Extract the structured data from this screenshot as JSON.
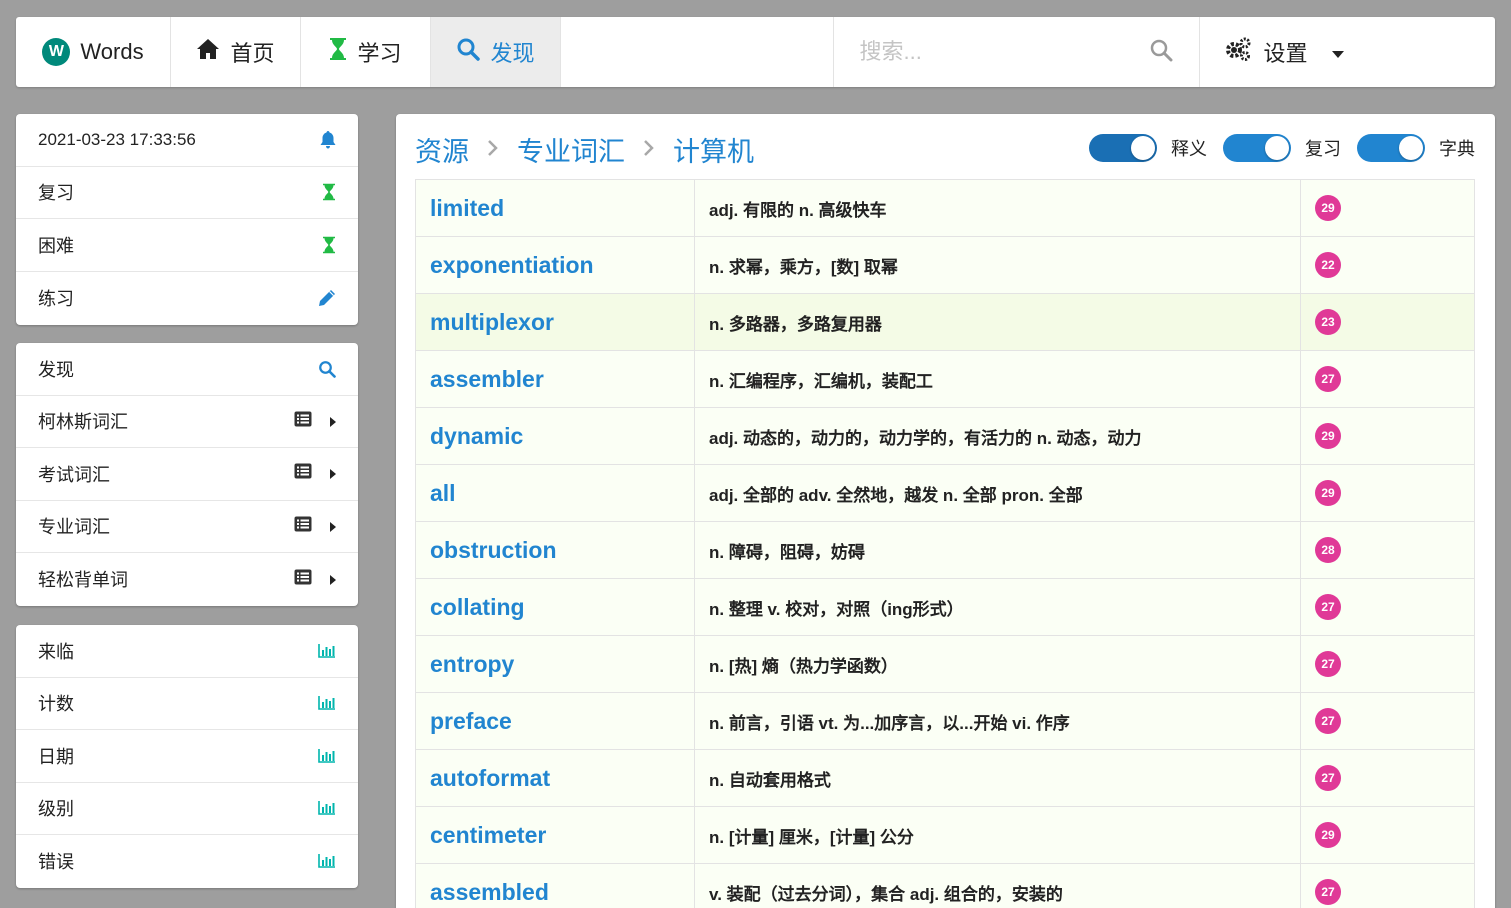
{
  "nav": {
    "brand": "Words",
    "home": "首页",
    "study": "学习",
    "discover": "发现",
    "search_placeholder": "搜索...",
    "settings": "设置"
  },
  "sidebar": {
    "card1": [
      {
        "label": "2021-03-23 17:33:56",
        "icon": "bell-icon"
      },
      {
        "label": "复习",
        "icon": "hourglass-icon"
      },
      {
        "label": "困难",
        "icon": "hourglass-icon"
      },
      {
        "label": "练习",
        "icon": "pencil-icon"
      }
    ],
    "card2": [
      {
        "label": "发现",
        "icon": "search-icon"
      },
      {
        "label": "柯林斯词汇",
        "icon": "list-icon"
      },
      {
        "label": "考试词汇",
        "icon": "list-icon"
      },
      {
        "label": "专业词汇",
        "icon": "list-icon"
      },
      {
        "label": "轻松背单词",
        "icon": "list-icon"
      }
    ],
    "card3": [
      {
        "label": "来临",
        "icon": "bar-chart-icon"
      },
      {
        "label": "计数",
        "icon": "bar-chart-icon"
      },
      {
        "label": "日期",
        "icon": "bar-chart-icon"
      },
      {
        "label": "级别",
        "icon": "bar-chart-icon"
      },
      {
        "label": "错误",
        "icon": "bar-chart-icon"
      }
    ]
  },
  "breadcrumb": [
    "资源",
    "专业词汇",
    "计算机"
  ],
  "toggles": [
    {
      "label": "释义",
      "on": true
    },
    {
      "label": "复习",
      "on": true
    },
    {
      "label": "字典",
      "on": true
    }
  ],
  "words": [
    {
      "word": "limited",
      "def": "adj. 有限的 n. 高级快车",
      "count": "29"
    },
    {
      "word": "exponentiation",
      "def": "n. 求幂，乘方，[数] 取幂",
      "count": "22"
    },
    {
      "word": "multiplexor",
      "def": "n. 多路器，多路复用器",
      "count": "23"
    },
    {
      "word": "assembler",
      "def": "n. 汇编程序，汇编机，装配工",
      "count": "27"
    },
    {
      "word": "dynamic",
      "def": "adj. 动态的，动力的，动力学的，有活力的 n. 动态，动力",
      "count": "29"
    },
    {
      "word": "all",
      "def": "adj. 全部的 adv. 全然地，越发 n. 全部 pron. 全部",
      "count": "29"
    },
    {
      "word": "obstruction",
      "def": "n. 障碍，阻碍，妨碍",
      "count": "28"
    },
    {
      "word": "collating",
      "def": "n. 整理 v. 校对，对照（ing形式）",
      "count": "27"
    },
    {
      "word": "entropy",
      "def": "n. [热] 熵（热力学函数）",
      "count": "27"
    },
    {
      "word": "preface",
      "def": "n. 前言，引语 vt. 为...加序言，以...开始 vi. 作序",
      "count": "27"
    },
    {
      "word": "autoformat",
      "def": "n. 自动套用格式",
      "count": "27"
    },
    {
      "word": "centimeter",
      "def": "n. [计量] 厘米，[计量] 公分",
      "count": "29"
    },
    {
      "word": "assembled",
      "def": "v. 装配（过去分词），集合 adj. 组合的，安装的",
      "count": "27"
    }
  ],
  "colors": {
    "accent": "#2185d0",
    "badge": "#e03997",
    "green_icon": "#21ba45",
    "teal_icon": "#00b5ad"
  }
}
